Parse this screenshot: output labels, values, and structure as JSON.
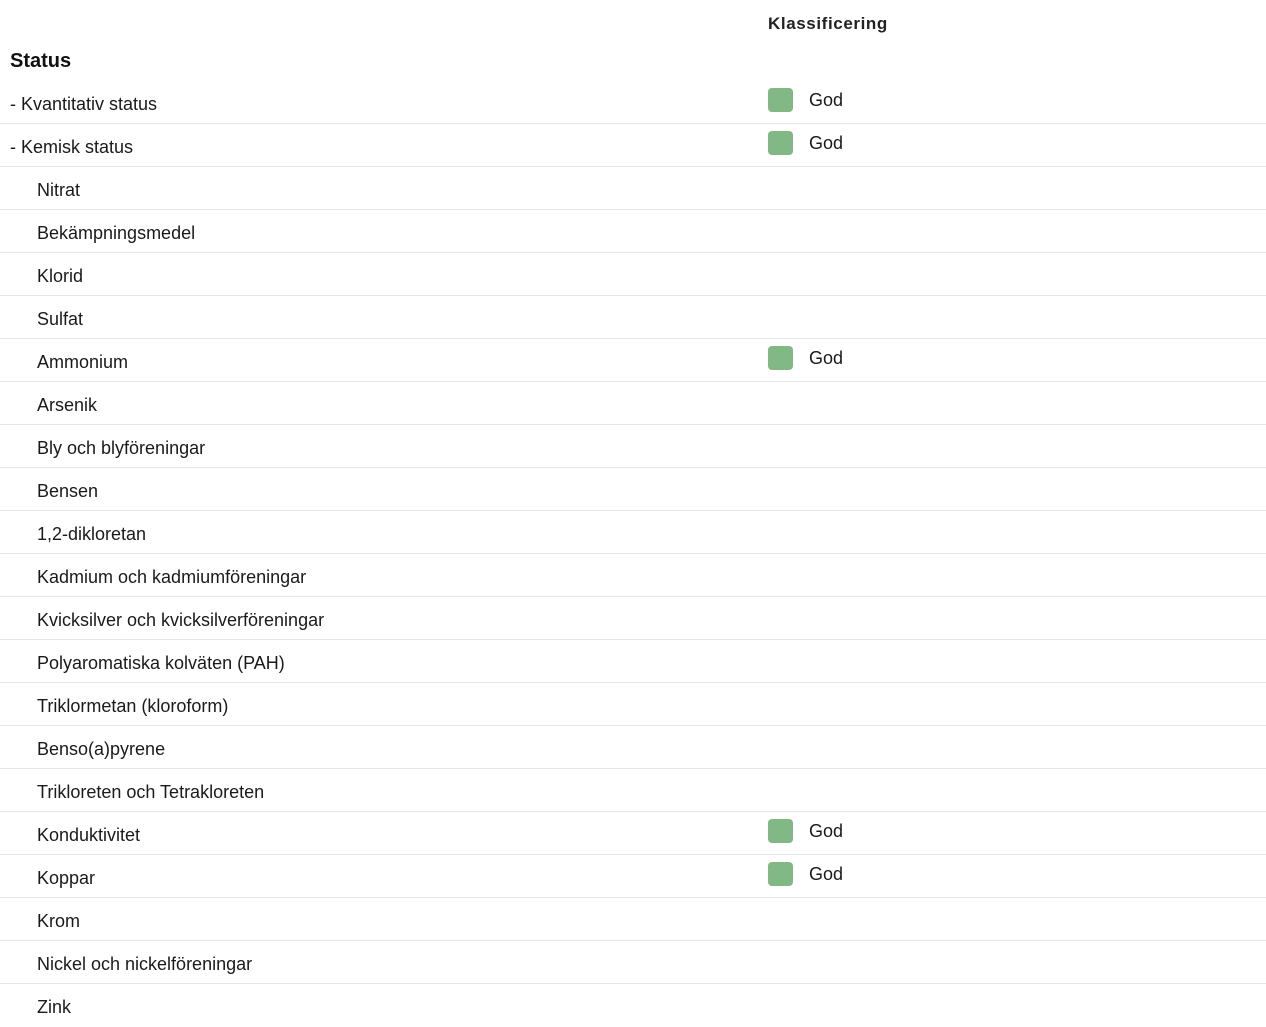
{
  "header": {
    "classification_label": "Klassificering"
  },
  "section": {
    "title": "Status"
  },
  "colors": {
    "good": "#82b885",
    "divider": "#e6e6e6"
  },
  "rows": [
    {
      "label": "- Kvantitativ status",
      "level": 1,
      "classification": "God"
    },
    {
      "label": "- Kemisk status",
      "level": 1,
      "classification": "God"
    },
    {
      "label": "Nitrat",
      "level": 2,
      "classification": ""
    },
    {
      "label": "Bekämpningsmedel",
      "level": 2,
      "classification": ""
    },
    {
      "label": "Klorid",
      "level": 2,
      "classification": ""
    },
    {
      "label": "Sulfat",
      "level": 2,
      "classification": ""
    },
    {
      "label": "Ammonium",
      "level": 2,
      "classification": "God"
    },
    {
      "label": "Arsenik",
      "level": 2,
      "classification": ""
    },
    {
      "label": "Bly och blyföreningar",
      "level": 2,
      "classification": ""
    },
    {
      "label": "Bensen",
      "level": 2,
      "classification": ""
    },
    {
      "label": "1,2-dikloretan",
      "level": 2,
      "classification": ""
    },
    {
      "label": "Kadmium och kadmiumföreningar",
      "level": 2,
      "classification": ""
    },
    {
      "label": "Kvicksilver och kvicksilverföreningar",
      "level": 2,
      "classification": ""
    },
    {
      "label": "Polyaromatiska kolväten (PAH)",
      "level": 2,
      "classification": ""
    },
    {
      "label": "Triklormetan (kloroform)",
      "level": 2,
      "classification": ""
    },
    {
      "label": "Benso(a)pyrene",
      "level": 2,
      "classification": ""
    },
    {
      "label": "Trikloreten och Tetrakloreten",
      "level": 2,
      "classification": ""
    },
    {
      "label": "Konduktivitet",
      "level": 2,
      "classification": "God"
    },
    {
      "label": "Koppar",
      "level": 2,
      "classification": "God"
    },
    {
      "label": "Krom",
      "level": 2,
      "classification": ""
    },
    {
      "label": "Nickel och nickelföreningar",
      "level": 2,
      "classification": ""
    },
    {
      "label": "Zink",
      "level": 2,
      "classification": ""
    }
  ]
}
